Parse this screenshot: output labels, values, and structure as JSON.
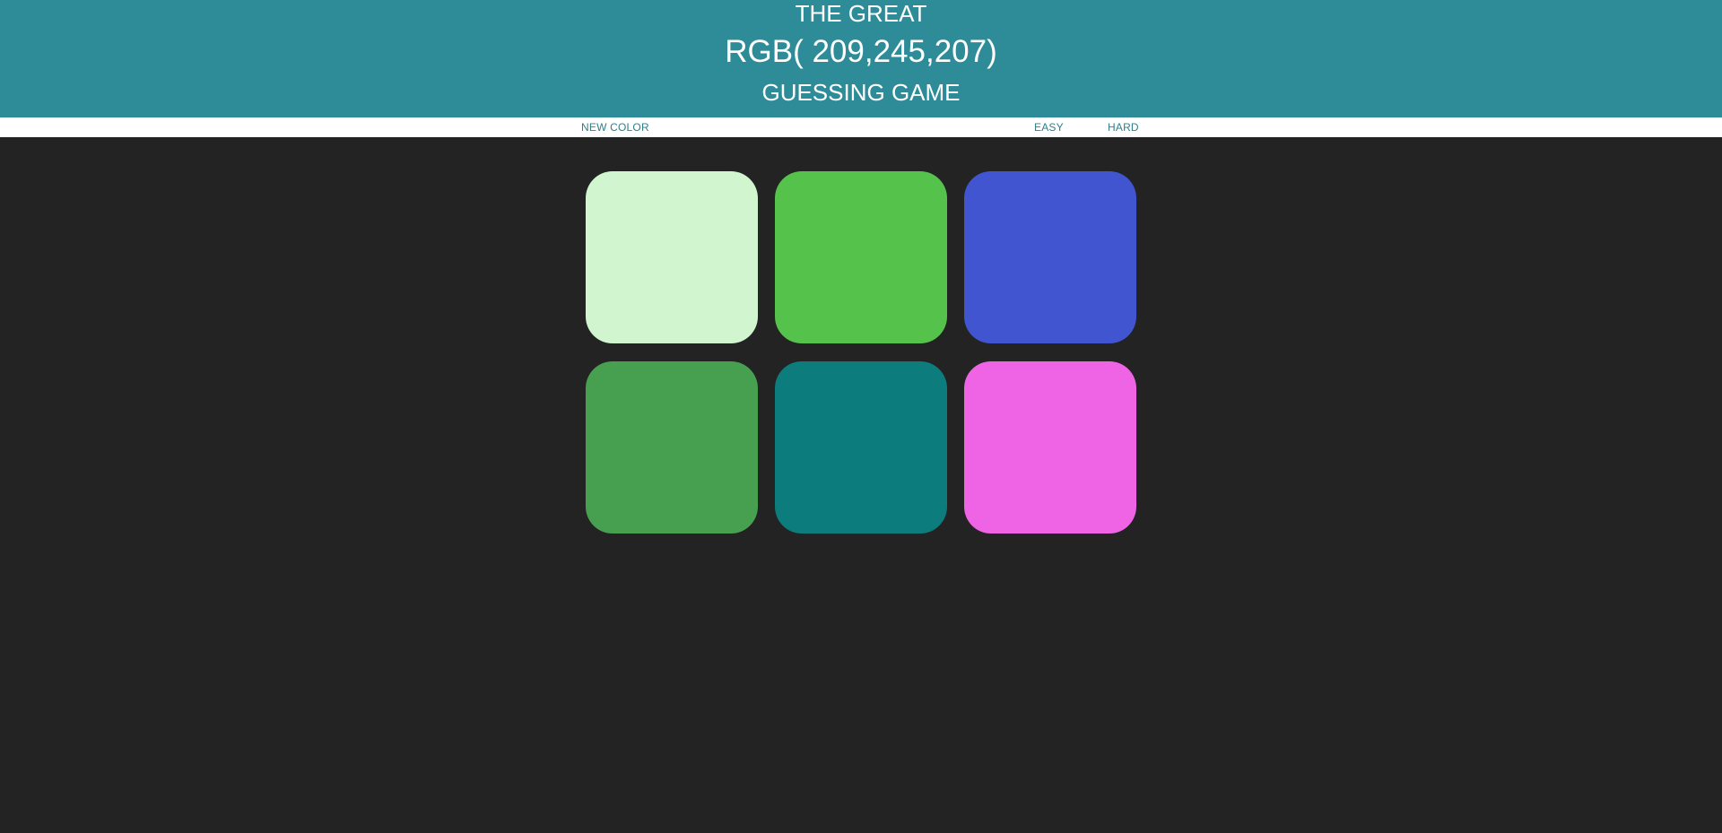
{
  "header": {
    "line1": "THE GREAT",
    "rgb_display": "RGB( 209,245,207)",
    "line3": "GUESSING GAME",
    "background_color": "#2e8c99"
  },
  "controls": {
    "new_color_label": "NEW COLOR",
    "easy_label": "EASY",
    "hard_label": "HARD"
  },
  "board": {
    "background_color": "#232323",
    "squares": [
      {
        "color": "#d1f5cf"
      },
      {
        "color": "#55c24c"
      },
      {
        "color": "#4155d1"
      },
      {
        "color": "#479f50"
      },
      {
        "color": "#0c7c7c"
      },
      {
        "color": "#ef64e4"
      }
    ]
  }
}
